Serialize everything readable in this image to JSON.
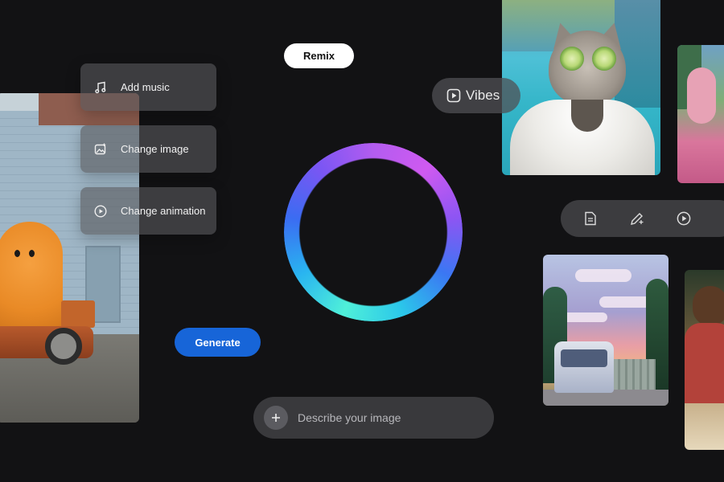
{
  "menu": {
    "items": [
      {
        "label": "Add music",
        "icon": "music-note-icon"
      },
      {
        "label": "Change image",
        "icon": "image-sparkle-icon"
      },
      {
        "label": "Change animation",
        "icon": "play-circle-icon"
      }
    ]
  },
  "remix": {
    "label": "Remix"
  },
  "vibes": {
    "label": "Vibes",
    "icon": "play-square-icon"
  },
  "generate": {
    "label": "Generate",
    "color": "#1765d8"
  },
  "prompt": {
    "placeholder": "Describe your image",
    "icon": "plus-icon"
  },
  "toolbar": {
    "icons": [
      "document-icon",
      "pencil-sparkle-icon",
      "play-circle-icon"
    ]
  },
  "colors": {
    "background": "#121214",
    "ring_gradient": [
      "#4ff0d9",
      "#29b4f0",
      "#3b6cf2",
      "#7a56f3",
      "#cf5af0"
    ]
  }
}
